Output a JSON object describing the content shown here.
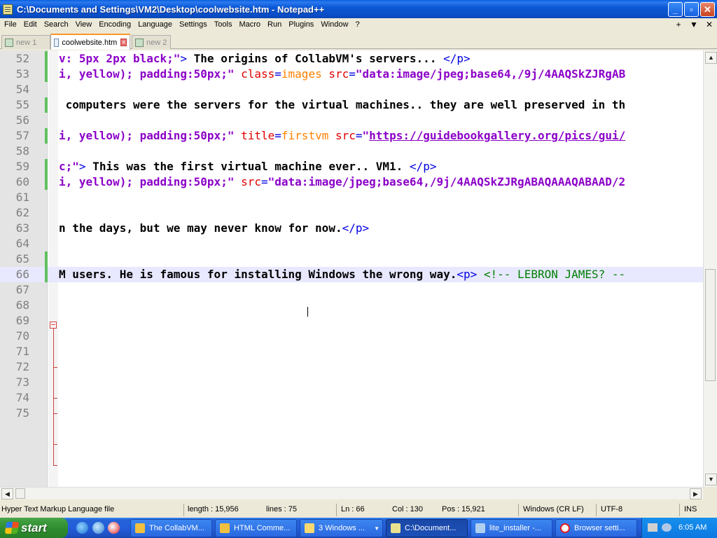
{
  "window": {
    "title": "C:\\Documents and Settings\\VM2\\Desktop\\coolwebsite.htm - Notepad++",
    "minimize": "_",
    "maximize": "▫",
    "close": "✕"
  },
  "menu": [
    "File",
    "Edit",
    "Search",
    "View",
    "Encoding",
    "Language",
    "Settings",
    "Tools",
    "Macro",
    "Run",
    "Plugins",
    "Window",
    "?"
  ],
  "menu_right": [
    "+",
    "▼",
    "✕"
  ],
  "tabs": [
    {
      "label": "new 1",
      "active": false
    },
    {
      "label": "coolwebsite.htm",
      "active": true
    },
    {
      "label": "new 2",
      "active": false
    }
  ],
  "editor": {
    "lines": [
      {
        "n": "52",
        "parts": [
          [
            "c-css",
            "v: 5px 2px black;\""
          ],
          [
            "c-tag",
            ">"
          ],
          [
            "c-txt",
            " The origins of CollabVM's servers... "
          ],
          [
            "c-tag",
            "</p>"
          ]
        ]
      },
      {
        "n": "53",
        "parts": [
          [
            "c-css",
            "i, yellow); padding:50px;\""
          ],
          [
            "c-txt",
            " "
          ],
          [
            "c-attr",
            "class"
          ],
          [
            "c-tag",
            "="
          ],
          [
            "c-val",
            "images"
          ],
          [
            "c-txt",
            " "
          ],
          [
            "c-attr",
            "src"
          ],
          [
            "c-tag",
            "="
          ],
          [
            "c-str",
            "\"data:image/jpeg;base64,/9j/4AAQSkZJRgAB"
          ]
        ]
      },
      {
        "n": "54",
        "parts": []
      },
      {
        "n": "55",
        "parts": [
          [
            "c-txt",
            " computers were the servers for the virtual machines.. they are well preserved in th"
          ]
        ]
      },
      {
        "n": "56",
        "parts": []
      },
      {
        "n": "57",
        "parts": [
          [
            "c-css",
            "i, yellow); padding:50px;\""
          ],
          [
            "c-txt",
            " "
          ],
          [
            "c-attr",
            "title"
          ],
          [
            "c-tag",
            "="
          ],
          [
            "c-val",
            "firstvm"
          ],
          [
            "c-txt",
            " "
          ],
          [
            "c-attr",
            "src"
          ],
          [
            "c-tag",
            "="
          ],
          [
            "c-str",
            "\""
          ],
          [
            "c-url",
            "https://guidebookgallery.org/pics/gui/"
          ]
        ]
      },
      {
        "n": "58",
        "parts": []
      },
      {
        "n": "59",
        "parts": [
          [
            "c-css",
            "c;\""
          ],
          [
            "c-tag",
            ">"
          ],
          [
            "c-txt",
            " This was the first virtual machine ever.. VM1. "
          ],
          [
            "c-tag",
            "</p>"
          ]
        ]
      },
      {
        "n": "60",
        "parts": [
          [
            "c-css",
            "i, yellow); padding:50px;\""
          ],
          [
            "c-txt",
            " "
          ],
          [
            "c-attr",
            "src"
          ],
          [
            "c-tag",
            "="
          ],
          [
            "c-str",
            "\"data:image/jpeg;base64,/9j/4AAQSkZJRgABAQAAAQABAAD/2"
          ]
        ]
      },
      {
        "n": "61",
        "parts": []
      },
      {
        "n": "62",
        "parts": []
      },
      {
        "n": "63",
        "parts": [
          [
            "c-txt",
            "n the days, but we may never know for now."
          ],
          [
            "c-tag",
            "</p>"
          ]
        ]
      },
      {
        "n": "64",
        "parts": []
      },
      {
        "n": "65",
        "parts": []
      },
      {
        "n": "66",
        "parts": [
          [
            "c-txt",
            "M users. He is famous for installing Windows the wrong way."
          ],
          [
            "c-tag",
            "<p>"
          ],
          [
            "c-txt",
            " "
          ],
          [
            "c-com",
            "<!-- LEBRON JAMES? --"
          ]
        ]
      },
      {
        "n": "67",
        "parts": []
      },
      {
        "n": "68",
        "parts": []
      },
      {
        "n": "69",
        "parts": []
      },
      {
        "n": "70",
        "parts": []
      },
      {
        "n": "71",
        "parts": []
      },
      {
        "n": "72",
        "parts": []
      },
      {
        "n": "73",
        "parts": []
      },
      {
        "n": "74",
        "parts": []
      },
      {
        "n": "75",
        "parts": []
      }
    ]
  },
  "status": {
    "filetype": "Hyper Text Markup Language file",
    "length": "length : 15,956",
    "lines": "lines : 75",
    "ln": "Ln : 66",
    "col": "Col : 130",
    "pos": "Pos : 15,921",
    "eol": "Windows (CR LF)",
    "encoding": "UTF-8",
    "mode": "INS"
  },
  "taskbar": {
    "start": "start",
    "tasks": [
      {
        "label": "The CollabVM...",
        "active": false
      },
      {
        "label": "HTML Comme...",
        "active": false
      },
      {
        "label": "3 Windows ...",
        "active": false
      },
      {
        "label": "C:\\Document...",
        "active": true
      },
      {
        "label": "lite_installer -...",
        "active": false
      },
      {
        "label": "Browser setti...",
        "active": false
      }
    ],
    "clock": "6:05 AM"
  }
}
